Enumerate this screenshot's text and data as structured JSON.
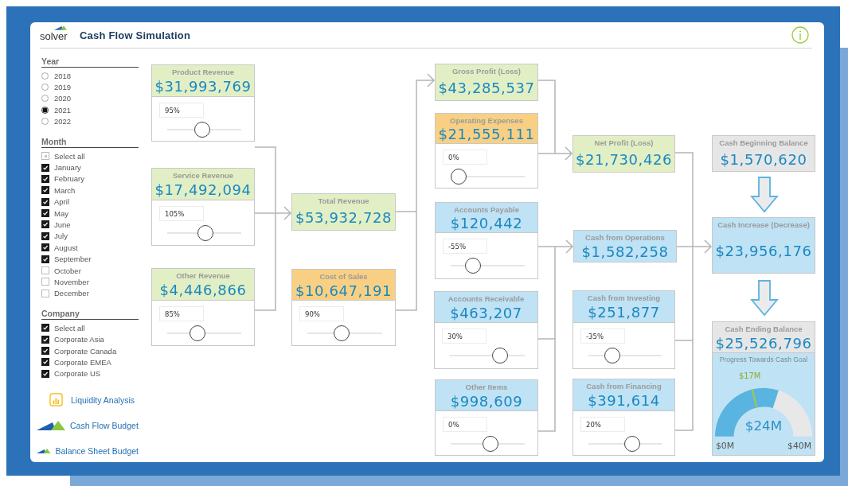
{
  "header": {
    "logo": "solver",
    "title": "Cash Flow Simulation"
  },
  "filters": {
    "year": {
      "title": "Year",
      "items": [
        {
          "label": "2018",
          "selected": false
        },
        {
          "label": "2019",
          "selected": false
        },
        {
          "label": "2020",
          "selected": false
        },
        {
          "label": "2021",
          "selected": true
        },
        {
          "label": "2022",
          "selected": false
        }
      ]
    },
    "month": {
      "title": "Month",
      "items": [
        {
          "label": "Select all",
          "checked": false,
          "partial": true
        },
        {
          "label": "January",
          "checked": true,
          "partial": false
        },
        {
          "label": "February",
          "checked": true,
          "partial": false
        },
        {
          "label": "March",
          "checked": true,
          "partial": false
        },
        {
          "label": "April",
          "checked": true,
          "partial": false
        },
        {
          "label": "May",
          "checked": true,
          "partial": false
        },
        {
          "label": "June",
          "checked": true,
          "partial": false
        },
        {
          "label": "July",
          "checked": true,
          "partial": false
        },
        {
          "label": "August",
          "checked": true,
          "partial": false
        },
        {
          "label": "September",
          "checked": true,
          "partial": false
        },
        {
          "label": "October",
          "checked": false,
          "partial": false
        },
        {
          "label": "November",
          "checked": false,
          "partial": false
        },
        {
          "label": "December",
          "checked": false,
          "partial": false
        }
      ]
    },
    "company": {
      "title": "Company",
      "items": [
        {
          "label": "Select all",
          "checked": true,
          "partial": false
        },
        {
          "label": "Corporate Asia",
          "checked": true,
          "partial": false
        },
        {
          "label": "Corporate Canada",
          "checked": true,
          "partial": false
        },
        {
          "label": "Corporate EMEA",
          "checked": true,
          "partial": false
        },
        {
          "label": "Corporate US",
          "checked": true,
          "partial": false
        }
      ]
    }
  },
  "links": [
    {
      "label": "Liquidity Analysis",
      "kind": "report"
    },
    {
      "label": "Cash Flow Budget",
      "kind": "app"
    },
    {
      "label": "Balance Sheet Budget",
      "kind": "app"
    }
  ],
  "cards": [
    {
      "title": "Product Revenue",
      "value": "$31,993,769",
      "color": "#e2efc5",
      "slider": {
        "input": "95%",
        "level": 0.46
      }
    },
    {
      "title": "Service Revenue",
      "value": "$17,492,094",
      "color": "#e2efc5",
      "slider": {
        "input": "105%",
        "level": 0.52
      }
    },
    {
      "title": "Other Revenue",
      "value": "$4,446,866",
      "color": "#e2efc5",
      "slider": {
        "input": "85%",
        "level": 0.39
      }
    },
    {
      "title": "Total Revenue",
      "value": "$53,932,728",
      "color": "#e2efc5"
    },
    {
      "title": "Cost of Sales",
      "value": "$10,647,191",
      "color": "#f9d083",
      "slider": {
        "input": "90%",
        "level": 0.44
      }
    },
    {
      "title": "Gross Profit (Loss)",
      "value": "$43,285,537",
      "color": "#e2efc5"
    },
    {
      "title": "Operating Expenses",
      "value": "$21,555,111",
      "color": "#f9d083",
      "slider": {
        "input": "0%",
        "level": 0
      }
    },
    {
      "title": "Accounts Payable",
      "value": "$120,442",
      "color": "#bfe2f4",
      "slider": {
        "input": "-55%",
        "level": 0.25
      }
    },
    {
      "title": "Accounts Receivable",
      "value": "$463,207",
      "color": "#bfe2f4",
      "slider": {
        "input": "30%",
        "level": 0.72
      }
    },
    {
      "title": "Other Items",
      "value": "$998,609",
      "color": "#bfe2f4",
      "slider": {
        "input": "0%",
        "level": 0.55
      }
    },
    {
      "title": "Net Profit (Loss)",
      "value": "$21,730,426",
      "color": "#e2efc5"
    },
    {
      "title": "Cash from Operations",
      "value": "$1,582,258",
      "color": "#bfe2f4"
    },
    {
      "title": "Cash from Investing",
      "value": "$251,877",
      "color": "#bfe2f4",
      "slider": {
        "input": "-35%",
        "level": 0.28
      }
    },
    {
      "title": "Cash from Financing",
      "value": "$391,614",
      "color": "#bfe2f4",
      "slider": {
        "input": "20%",
        "level": 0.62
      }
    },
    {
      "title": "Cash Beginning Balance",
      "value": "$1,570,620",
      "color": "#e6e6e6"
    },
    {
      "title": "Cash Increase (Decrease)",
      "value": "$23,956,176",
      "color": "#bfe2f4"
    },
    {
      "title": "Cash Ending Balance",
      "value": "$25,526,796",
      "color": "#e6e6e6",
      "gauge": {
        "title": "Progress Towards Cash Goal",
        "level": 0.6,
        "value": "$24M",
        "min": "$0M",
        "max": "$40M",
        "target": {
          "label": "$17M",
          "level": 0.425
        }
      }
    }
  ]
}
